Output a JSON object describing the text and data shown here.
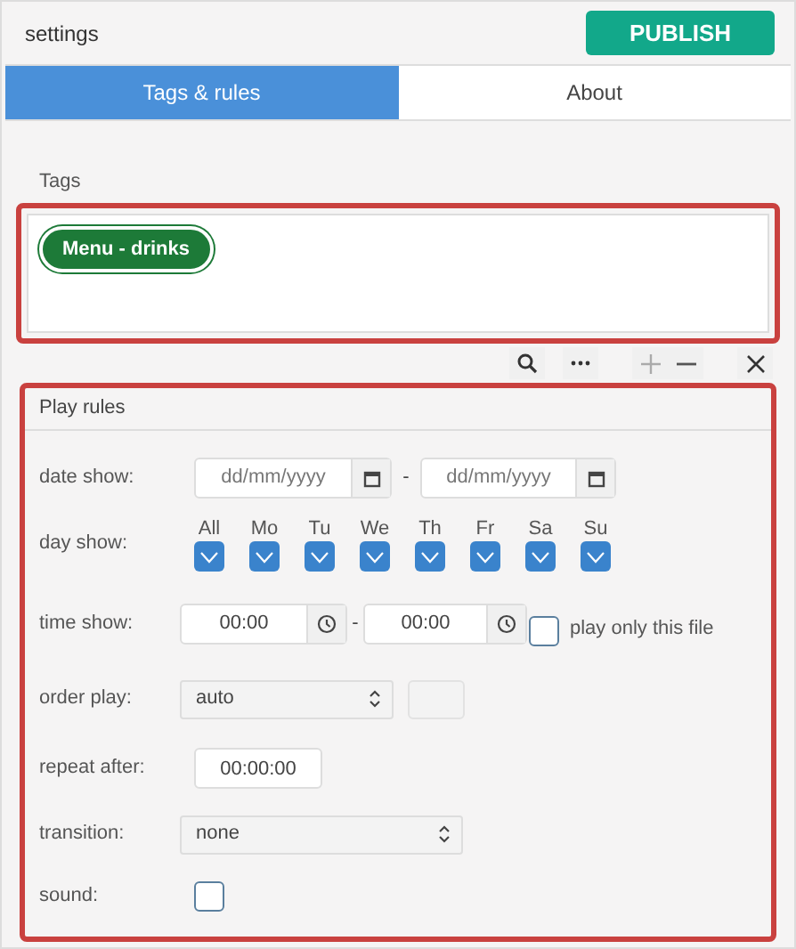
{
  "header": {
    "title": "settings",
    "publish_button": "PUBLISH"
  },
  "tabs": [
    {
      "label": "Tags & rules",
      "selected": true
    },
    {
      "label": "About",
      "selected": false
    }
  ],
  "tags_section": {
    "label": "Tags",
    "tags": [
      {
        "label": "Menu - drinks"
      }
    ]
  },
  "play_rules": {
    "title": "Play rules",
    "date_show": {
      "label": "date show:",
      "from_placeholder": "dd/mm/yyyy",
      "separator": "-",
      "to_placeholder": "dd/mm/yyyy"
    },
    "day_show": {
      "label": "day show:",
      "days": [
        {
          "label": "All",
          "checked": true
        },
        {
          "label": "Mo",
          "checked": true
        },
        {
          "label": "Tu",
          "checked": true
        },
        {
          "label": "We",
          "checked": true
        },
        {
          "label": "Th",
          "checked": true
        },
        {
          "label": "Fr",
          "checked": true
        },
        {
          "label": "Sa",
          "checked": true
        },
        {
          "label": "Su",
          "checked": true
        }
      ]
    },
    "time_show": {
      "label": "time show:",
      "from": "00:00",
      "separator": "-",
      "to": "00:00",
      "play_only_this_file": {
        "label": "play only this file",
        "checked": false
      }
    },
    "order_play": {
      "label": "order play:",
      "value": "auto"
    },
    "repeat_after": {
      "label": "repeat after:",
      "value": "00:00:00"
    },
    "transition": {
      "label": "transition:",
      "value": "none"
    },
    "sound": {
      "label": "sound:",
      "checked": false
    }
  }
}
